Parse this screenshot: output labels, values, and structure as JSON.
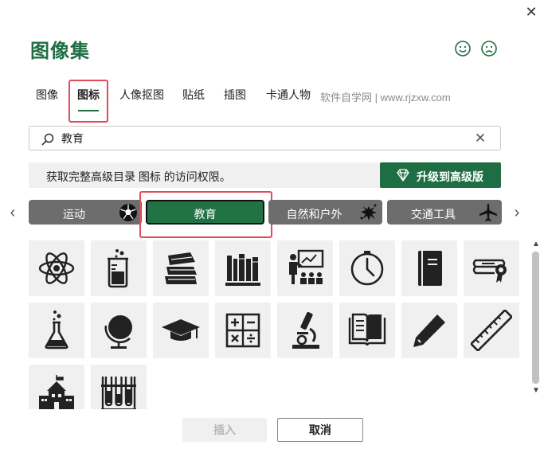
{
  "dialog": {
    "title": "图像集",
    "close_glyph": "✕",
    "feedback": {
      "smile_icon": "smile-face-icon",
      "frown_icon": "frown-face-icon"
    }
  },
  "tabs": [
    {
      "label": "图像",
      "selected": false
    },
    {
      "label": "图标",
      "selected": true
    },
    {
      "label": "人像抠图",
      "selected": false
    },
    {
      "label": "贴纸",
      "selected": false
    },
    {
      "label": "插图",
      "selected": false
    },
    {
      "label": "卡通人物",
      "selected": false
    }
  ],
  "watermark": "软件自学网 | www.rjzxw.com",
  "search": {
    "value": "教育",
    "placeholder": "",
    "clear_glyph": "✕"
  },
  "notice": {
    "text": "获取完整高级目录 图标 的访问权限。",
    "upgrade_label": "升级到高级版"
  },
  "categories": [
    {
      "label": "运动",
      "icon": "soccer-ball-icon",
      "selected": false
    },
    {
      "label": "教育",
      "icon": "",
      "selected": true
    },
    {
      "label": "自然和户外",
      "icon": "paint-splat-icon",
      "selected": false
    },
    {
      "label": "交通工具",
      "icon": "airplane-icon",
      "selected": false
    }
  ],
  "nav": {
    "prev_glyph": "‹",
    "next_glyph": "›"
  },
  "icons": [
    "atom-icon",
    "beaker-icon",
    "book-stack-icon",
    "bookshelf-icon",
    "teacher-presentation-icon",
    "clock-icon",
    "notebook-icon",
    "diploma-icon",
    "flask-icon",
    "globe-icon",
    "graduation-cap-icon",
    "math-symbols-icon",
    "microscope-icon",
    "open-book-icon",
    "pencil-icon",
    "ruler-icon",
    "school-building-icon",
    "test-tubes-icon"
  ],
  "footer": {
    "insert_label": "插入",
    "cancel_label": "取消"
  },
  "colors": {
    "accent": "#1f6e43",
    "category_bg": "#6d6d6d",
    "highlight": "#e24b5a",
    "tile_bg": "#f0f0f0"
  }
}
